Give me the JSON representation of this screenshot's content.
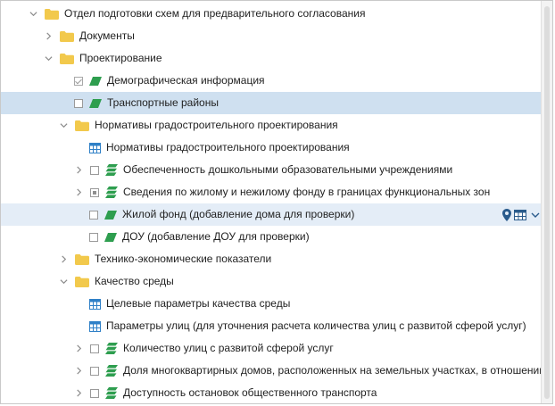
{
  "tree": {
    "rows": [
      {
        "label": "Отдел подготовки схем для предварительного согласования"
      },
      {
        "label": "Документы"
      },
      {
        "label": "Проектирование"
      },
      {
        "label": "Демографическая информация"
      },
      {
        "label": "Транспортные районы"
      },
      {
        "label": "Нормативы градостроительного проектирования"
      },
      {
        "label": "Нормативы градостроительного проектирования"
      },
      {
        "label": "Обеспеченность дошкольными образовательными учреждениями"
      },
      {
        "label": "Сведения по жилому и нежилому фонду в границах функциональных зон"
      },
      {
        "label": "Жилой фонд (добавление дома для проверки)"
      },
      {
        "label": "ДОУ (добавление ДОУ для проверки)"
      },
      {
        "label": "Технико-экономические показатели"
      },
      {
        "label": "Качество среды"
      },
      {
        "label": "Целевые параметры качества среды"
      },
      {
        "label": "Параметры улиц (для уточнения расчета количества улиц с развитой сферой услуг)"
      },
      {
        "label": "Количество улиц с развитой сферой услуг"
      },
      {
        "label": "Доля многоквартирных домов, расположенных на земельных участках, в отношении к…"
      },
      {
        "label": "Доступность остановок общественного транспорта"
      }
    ]
  },
  "colors": {
    "folder": "#f2c94c",
    "layer": "#2e9e4f",
    "table": "#2f80c7",
    "selected_row": "#cfe0f0",
    "hover_row": "#e4edf7",
    "action_icon": "#2a5b8c"
  }
}
